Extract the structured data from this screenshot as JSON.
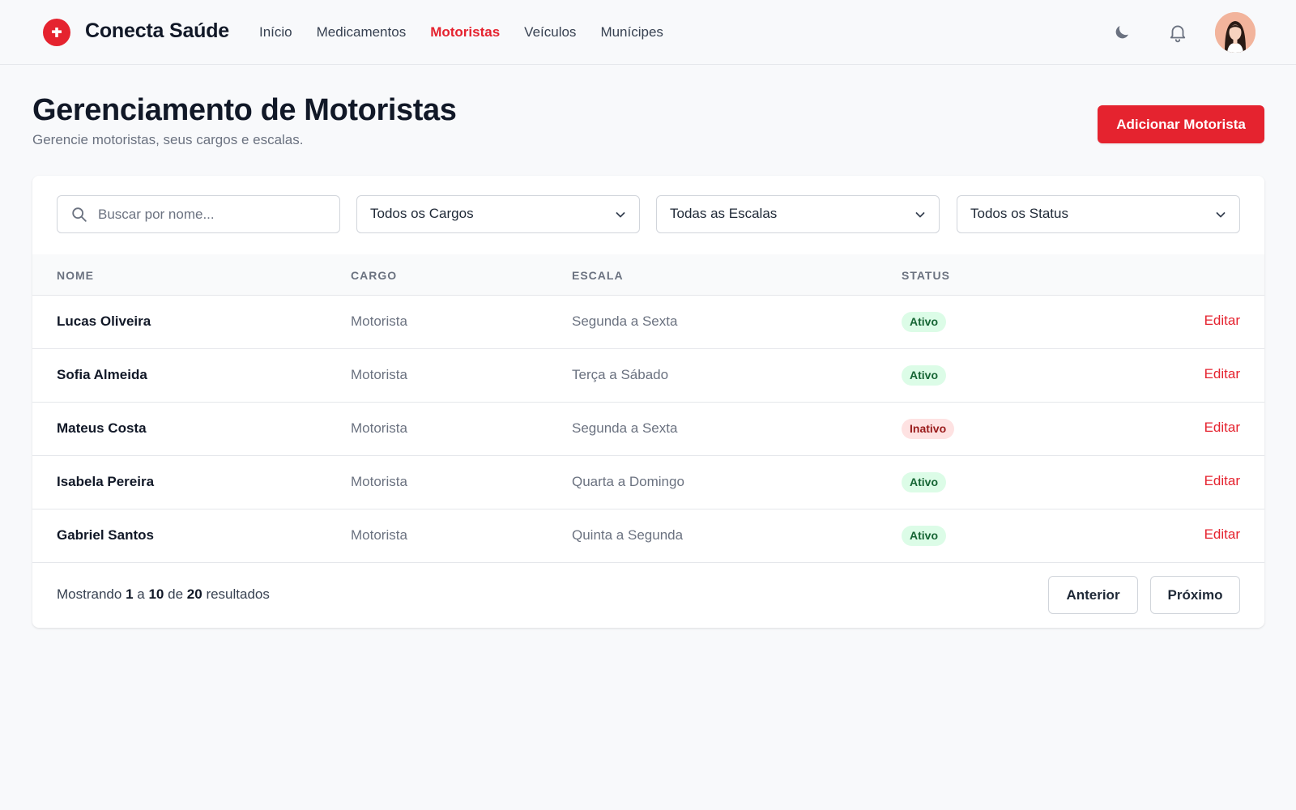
{
  "brand": {
    "name": "Conecta Saúde",
    "color": "#e5232f"
  },
  "nav": [
    {
      "label": "Início",
      "active": false
    },
    {
      "label": "Medicamentos",
      "active": false
    },
    {
      "label": "Motoristas",
      "active": true
    },
    {
      "label": "Veículos",
      "active": false
    },
    {
      "label": "Munícipes",
      "active": false
    }
  ],
  "header_icons": [
    "moon-icon",
    "bell-icon"
  ],
  "page": {
    "title": "Gerenciamento de Motoristas",
    "subtitle": "Gerencie motoristas, seus cargos e escalas.",
    "add_button": "Adicionar Motorista"
  },
  "filters": {
    "search_placeholder": "Buscar por nome...",
    "cargo": "Todos os Cargos",
    "escala": "Todas as Escalas",
    "status": "Todos os Status"
  },
  "table": {
    "headers": [
      "NOME",
      "CARGO",
      "ESCALA",
      "STATUS"
    ],
    "rows": [
      {
        "nome": "Lucas Oliveira",
        "cargo": "Motorista",
        "escala": "Segunda a Sexta",
        "status": "Ativo",
        "action": "Editar"
      },
      {
        "nome": "Sofia Almeida",
        "cargo": "Motorista",
        "escala": "Terça a Sábado",
        "status": "Ativo",
        "action": "Editar"
      },
      {
        "nome": "Mateus Costa",
        "cargo": "Motorista",
        "escala": "Segunda a Sexta",
        "status": "Inativo",
        "action": "Editar"
      },
      {
        "nome": "Isabela Pereira",
        "cargo": "Motorista",
        "escala": "Quarta a Domingo",
        "status": "Ativo",
        "action": "Editar"
      },
      {
        "nome": "Gabriel Santos",
        "cargo": "Motorista",
        "escala": "Quinta a Segunda",
        "status": "Ativo",
        "action": "Editar"
      }
    ]
  },
  "pagination": {
    "prefix": "Mostrando",
    "from": "1",
    "sep1": "a",
    "to": "10",
    "sep2": "de",
    "total": "20",
    "suffix": "resultados",
    "prev": "Anterior",
    "next": "Próximo"
  },
  "status_colors": {
    "Ativo": "#166534",
    "Inativo": "#991b1b"
  }
}
